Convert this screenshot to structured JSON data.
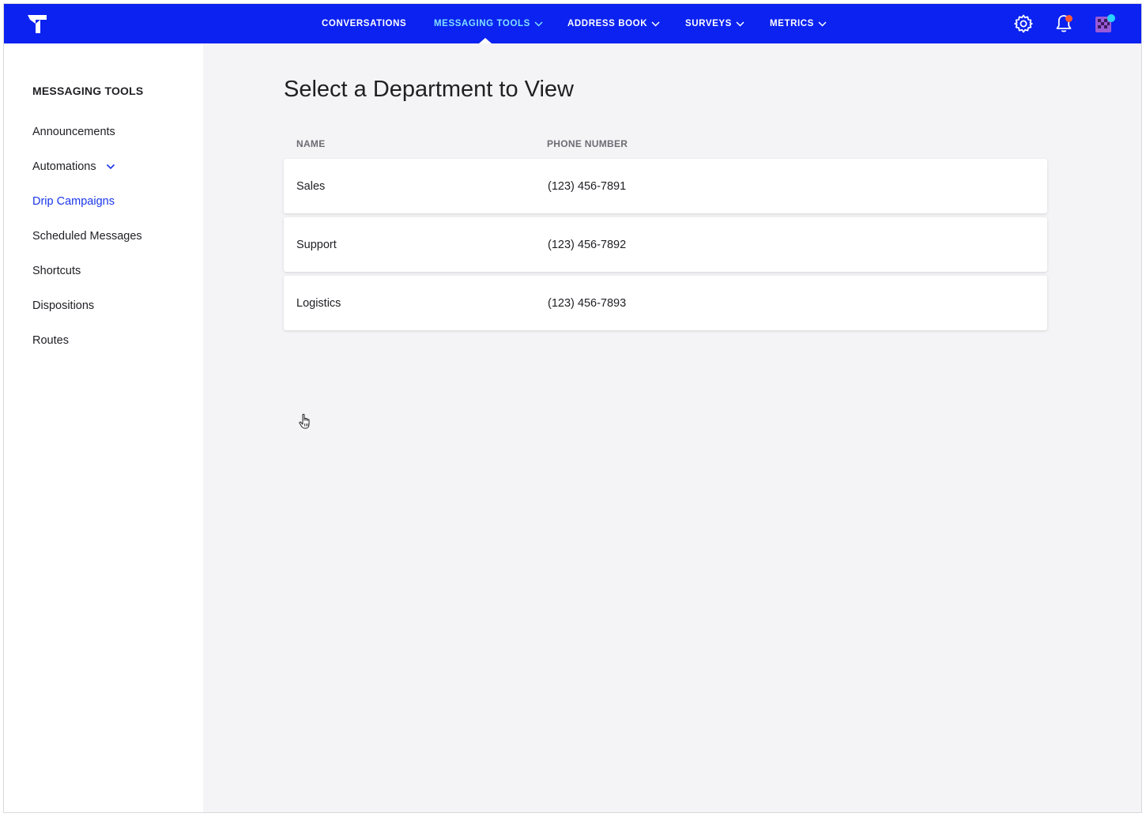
{
  "topbar": {
    "nav": [
      {
        "label": "CONVERSATIONS",
        "dropdown": false,
        "active": false
      },
      {
        "label": "MESSAGING TOOLS",
        "dropdown": true,
        "active": true
      },
      {
        "label": "ADDRESS BOOK",
        "dropdown": true,
        "active": false
      },
      {
        "label": "SURVEYS",
        "dropdown": true,
        "active": false
      },
      {
        "label": "METRICS",
        "dropdown": true,
        "active": false
      }
    ],
    "icons": [
      "logo-icon",
      "gear-icon",
      "bell-icon",
      "avatar"
    ],
    "colors": {
      "bar": "#0b22f0",
      "active_nav": "#7fe0ff",
      "notification_dot": "#ff5a36",
      "avatar_dot": "#29d3ff"
    }
  },
  "sidebar": {
    "title": "MESSAGING TOOLS",
    "items": [
      {
        "label": "Announcements"
      },
      {
        "label": "Automations",
        "expandable": true
      },
      {
        "label": "Drip Campaigns",
        "active": true
      },
      {
        "label": "Scheduled Messages"
      },
      {
        "label": "Shortcuts"
      },
      {
        "label": "Dispositions"
      },
      {
        "label": "Routes"
      }
    ]
  },
  "main": {
    "title": "Select a Department to View",
    "columns": {
      "name": "NAME",
      "phone": "PHONE NUMBER"
    },
    "rows": [
      {
        "name": "Sales",
        "phone": "(123) 456-7891"
      },
      {
        "name": "Support",
        "phone": "(123) 456-7892"
      },
      {
        "name": "Logistics",
        "phone": "(123) 456-7893"
      }
    ]
  }
}
